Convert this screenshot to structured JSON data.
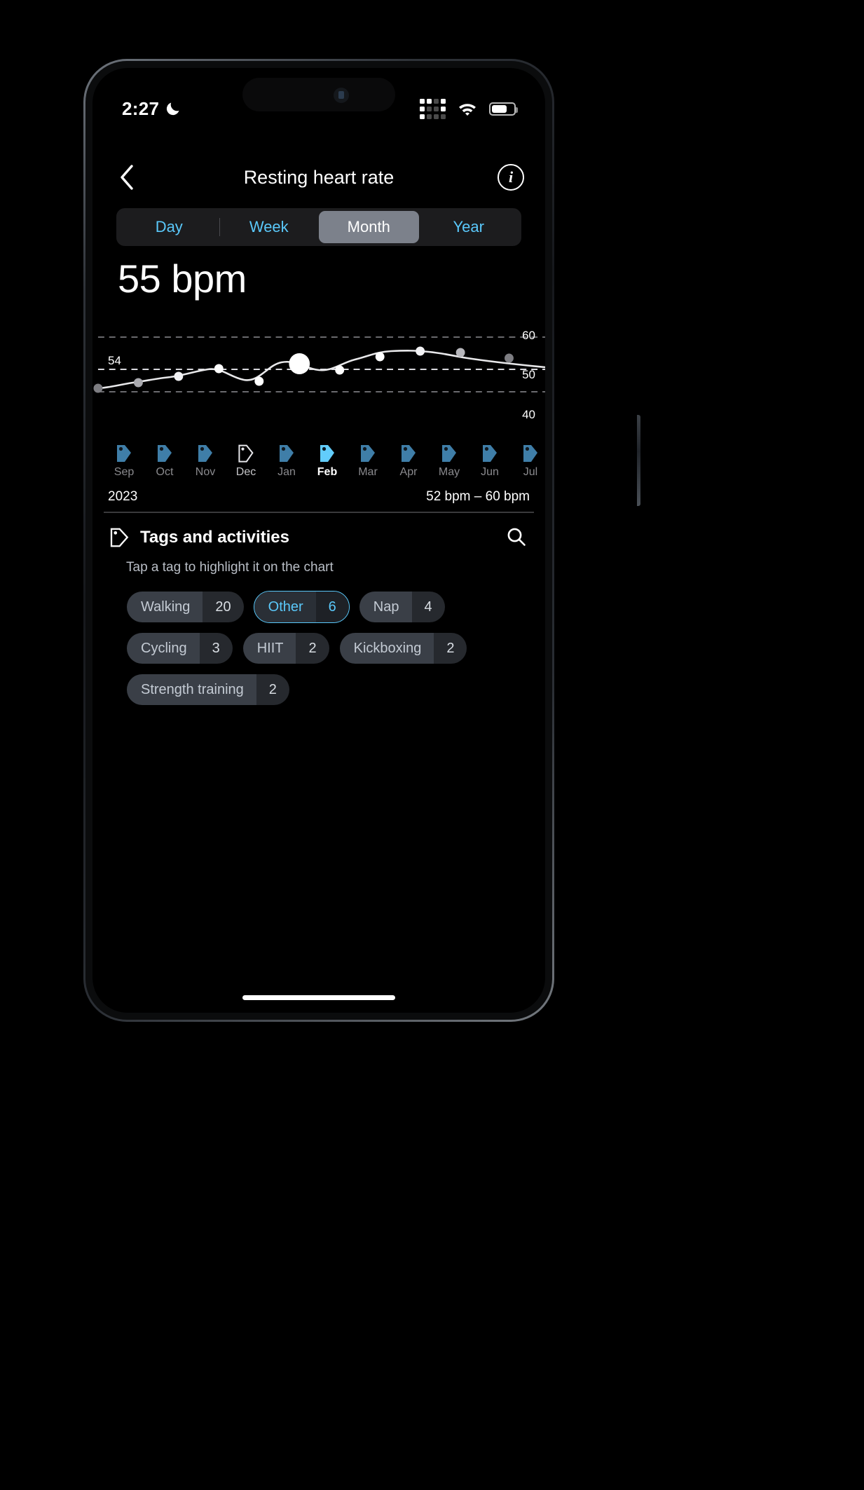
{
  "status_bar": {
    "time": "2:27",
    "moon_icon": "crescent-moon-icon",
    "signal_icon": "cellular-signal-icon",
    "wifi_icon": "wifi-icon",
    "battery_icon": "battery-icon",
    "battery_level_pct": 62
  },
  "nav": {
    "back_icon": "chevron-left-icon",
    "title": "Resting heart rate",
    "info_icon": "info-circle-icon",
    "info_glyph": "i"
  },
  "segmented_control": {
    "options": [
      {
        "label": "Day",
        "selected": false
      },
      {
        "label": "Week",
        "selected": false
      },
      {
        "label": "Month",
        "selected": true
      },
      {
        "label": "Year",
        "selected": false
      }
    ],
    "accent_color": "#5ac8fa",
    "selected_bg": "#7c818b"
  },
  "summary": {
    "value": "55 bpm"
  },
  "chart_card": {
    "year": "2023",
    "range": "52 bpm – 60 bpm",
    "highlight_label": "54"
  },
  "tags_section": {
    "tag_icon": "tag-icon",
    "title": "Tags and activities",
    "search_icon": "search-icon",
    "subtitle": "Tap a tag to highlight it on the chart",
    "chips": [
      {
        "label": "Walking",
        "count": "20",
        "selected": false
      },
      {
        "label": "Other",
        "count": "6",
        "selected": true
      },
      {
        "label": "Nap",
        "count": "4",
        "selected": false
      },
      {
        "label": "Cycling",
        "count": "3",
        "selected": false
      },
      {
        "label": "HIIT",
        "count": "2",
        "selected": false
      },
      {
        "label": "Kickboxing",
        "count": "2",
        "selected": false
      },
      {
        "label": "Strength training",
        "count": "2",
        "selected": false
      }
    ]
  },
  "chart_data": {
    "type": "line",
    "title": "Resting heart rate",
    "xlabel": "",
    "ylabel": "bpm",
    "ylim": [
      40,
      60
    ],
    "yticks": [
      40,
      50,
      60
    ],
    "ytick_labels": [
      "40",
      "50",
      "60"
    ],
    "grid": true,
    "grid_style": "dashed",
    "highlight_value": 54,
    "highlight_index": 5,
    "selected_category": "Feb",
    "value_range_label": "52 bpm – 60 bpm",
    "current_value": "55 bpm",
    "year": "2023",
    "categories": [
      "Sep",
      "Oct",
      "Nov",
      "Dec",
      "Jan",
      "Feb",
      "Mar",
      "Apr",
      "May",
      "Jun",
      "Jul"
    ],
    "values": [
      52,
      52.4,
      53,
      53.6,
      52.6,
      55,
      53.4,
      54.2,
      55.4,
      55.3,
      54.6
    ],
    "point_states": [
      "dim",
      "mid",
      "bright",
      "bright",
      "bright",
      "selected",
      "bright",
      "bright",
      "bright",
      "mid",
      "dim"
    ],
    "month_tags": [
      {
        "label": "Sep",
        "style": "muted",
        "tag_color": "#3f7ea8"
      },
      {
        "label": "Oct",
        "style": "muted",
        "tag_color": "#3f7ea8"
      },
      {
        "label": "Nov",
        "style": "muted",
        "tag_color": "#3f7ea8"
      },
      {
        "label": "Dec",
        "style": "outline",
        "tag_color": "#e6e6ea"
      },
      {
        "label": "Jan",
        "style": "muted",
        "tag_color": "#3f7ea8"
      },
      {
        "label": "Feb",
        "style": "active",
        "tag_color": "#62cdfb"
      },
      {
        "label": "Mar",
        "style": "muted",
        "tag_color": "#3f7ea8"
      },
      {
        "label": "Apr",
        "style": "muted",
        "tag_color": "#3f7ea8"
      },
      {
        "label": "May",
        "style": "muted",
        "tag_color": "#3f7ea8"
      },
      {
        "label": "Jun",
        "style": "muted",
        "tag_color": "#3f7ea8"
      },
      {
        "label": "Jul",
        "style": "muted",
        "tag_color": "#3f7ea8"
      }
    ]
  }
}
